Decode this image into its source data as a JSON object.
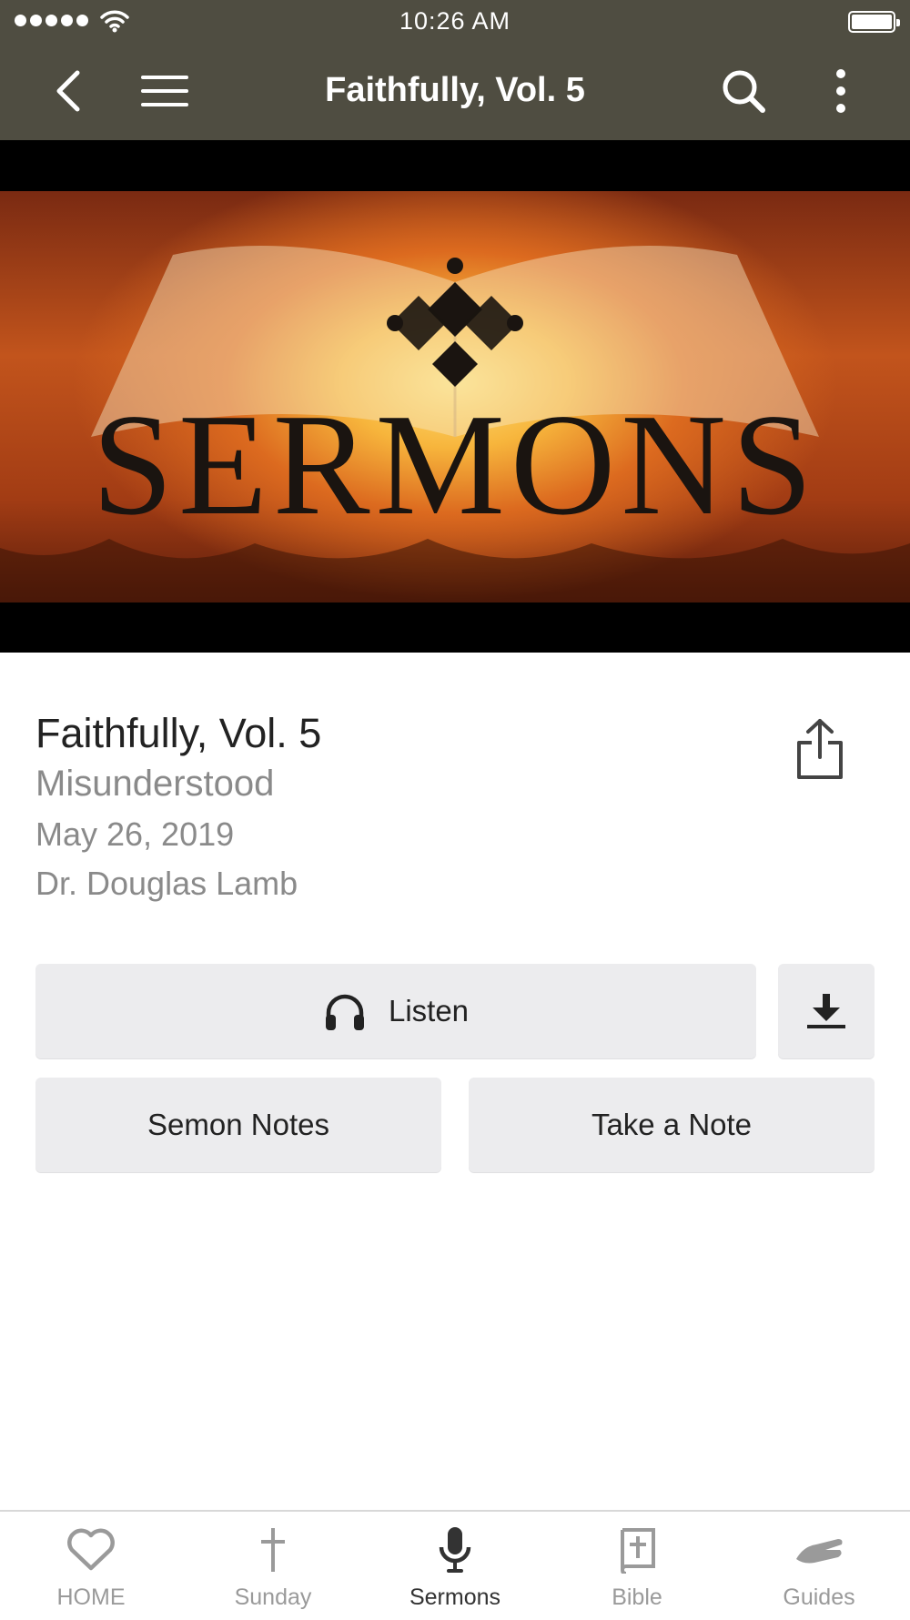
{
  "status_bar": {
    "time": "10:26 AM"
  },
  "nav": {
    "title": "Faithfully, Vol. 5"
  },
  "hero": {
    "text": "SERMONS"
  },
  "sermon": {
    "title": "Faithfully, Vol. 5",
    "subtitle": "Misunderstood",
    "date": "May 26, 2019",
    "speaker": "Dr. Douglas Lamb"
  },
  "actions": {
    "listen": "Listen",
    "sermon_notes": "Semon Notes",
    "take_note": "Take a Note"
  },
  "tabs": [
    {
      "label": "HOME",
      "icon": "heart-icon"
    },
    {
      "label": "Sunday",
      "icon": "cross-icon"
    },
    {
      "label": "Sermons",
      "icon": "microphone-icon",
      "active": true
    },
    {
      "label": "Bible",
      "icon": "bible-icon"
    },
    {
      "label": "Guides",
      "icon": "hand-icon"
    }
  ],
  "colors": {
    "nav_bg": "#4f4d41",
    "button_bg": "#ececee",
    "tab_inactive": "#9a9a9a",
    "tab_active": "#333333"
  }
}
